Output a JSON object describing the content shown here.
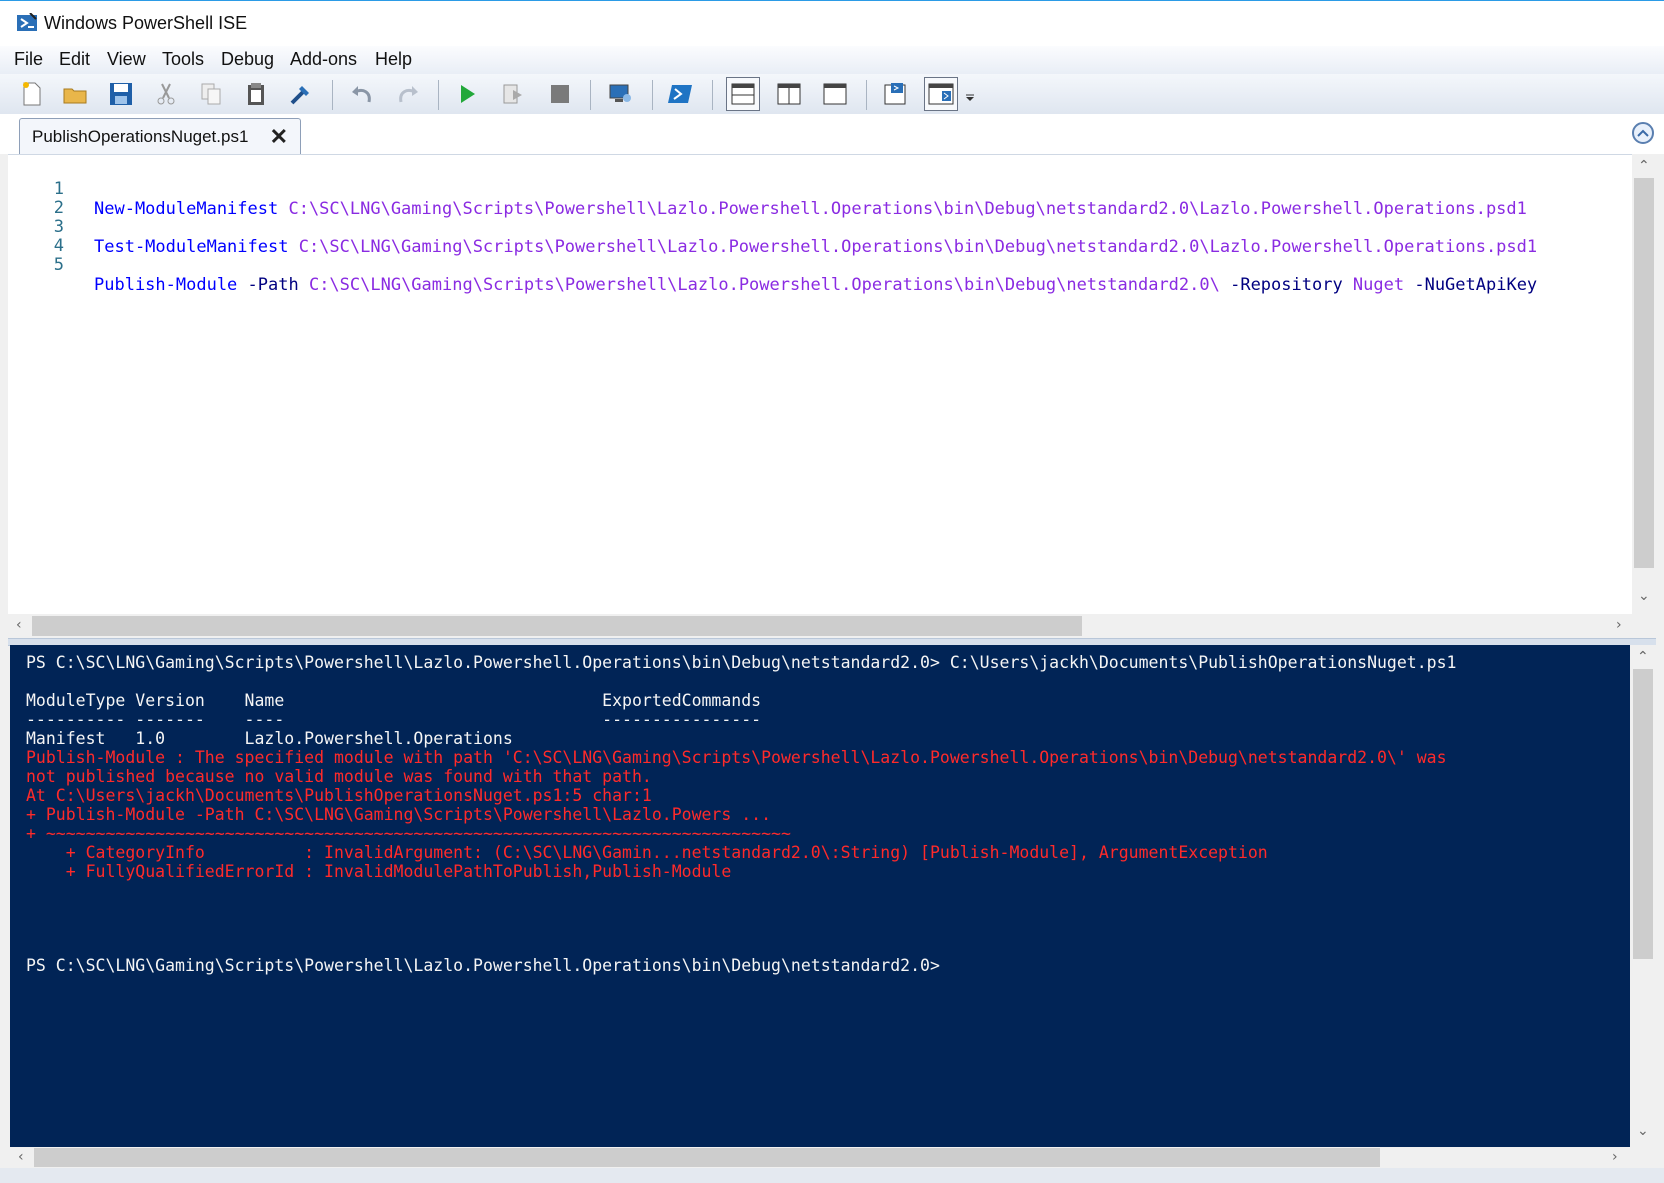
{
  "window": {
    "title": "Windows PowerShell ISE"
  },
  "menu": [
    "File",
    "Edit",
    "View",
    "Tools",
    "Debug",
    "Add-ons",
    "Help"
  ],
  "toolbar": {
    "buttons": [
      "new-file",
      "open",
      "save",
      "cut",
      "copy",
      "paste",
      "clear-console",
      "undo",
      "redo",
      "run-script",
      "run-selection",
      "stop",
      "new-remote-tab",
      "start-powershell",
      "show-script-pane-top",
      "show-script-pane-right",
      "show-script-pane-maximized",
      "show-script-pane",
      "show-commands",
      "toolbar-overflow"
    ]
  },
  "tabs": [
    {
      "label": "PublishOperationsNuget.ps1",
      "active": true
    }
  ],
  "editor": {
    "lines": [
      {
        "n": "1",
        "cmd": "New-ModuleManifest",
        "arg": " C:\\SC\\LNG\\Gaming\\Scripts\\Powershell\\Lazlo.Powershell.Operations\\bin\\Debug\\netstandard2.0\\Lazlo.Powershell.Operations.psd1"
      },
      {
        "n": "2"
      },
      {
        "n": "3",
        "cmd": "Test-ModuleManifest",
        "arg": " C:\\SC\\LNG\\Gaming\\Scripts\\Powershell\\Lazlo.Powershell.Operations\\bin\\Debug\\netstandard2.0\\Lazlo.Powershell.Operations.psd1"
      },
      {
        "n": "4"
      },
      {
        "n": "5",
        "cmd": "Publish-Module",
        "p1": " -Path",
        "arg": " C:\\SC\\LNG\\Gaming\\Scripts\\Powershell\\Lazlo.Powershell.Operations\\bin\\Debug\\netstandard2.0\\",
        "p2": " -Repository",
        "arg2": " Nuget",
        "p3": " -NuGetApiKey"
      }
    ]
  },
  "console": {
    "lines": [
      {
        "text": "PS C:\\SC\\LNG\\Gaming\\Scripts\\Powershell\\Lazlo.Powershell.Operations\\bin\\Debug\\netstandard2.0> C:\\Users\\jackh\\Documents\\PublishOperationsNuget.ps1",
        "type": "normal"
      },
      {
        "text": "",
        "type": "normal"
      },
      {
        "text": "ModuleType Version    Name                                ExportedCommands",
        "type": "normal"
      },
      {
        "text": "---------- -------    ----                                ----------------",
        "type": "normal"
      },
      {
        "text": "Manifest   1.0        Lazlo.Powershell.Operations",
        "type": "normal"
      },
      {
        "text": "Publish-Module : The specified module with path 'C:\\SC\\LNG\\Gaming\\Scripts\\Powershell\\Lazlo.Powershell.Operations\\bin\\Debug\\netstandard2.0\\' was",
        "type": "error"
      },
      {
        "text": "not published because no valid module was found with that path.",
        "type": "error"
      },
      {
        "text": "At C:\\Users\\jackh\\Documents\\PublishOperationsNuget.ps1:5 char:1",
        "type": "error"
      },
      {
        "text": "+ Publish-Module -Path C:\\SC\\LNG\\Gaming\\Scripts\\Powershell\\Lazlo.Powers ...",
        "type": "error"
      },
      {
        "text": "+ ~~~~~~~~~~~~~~~~~~~~~~~~~~~~~~~~~~~~~~~~~~~~~~~~~~~~~~~~~~~~~~~~~~~~~~~~~~~",
        "type": "error"
      },
      {
        "text": "    + CategoryInfo          : InvalidArgument: (C:\\SC\\LNG\\Gamin...netstandard2.0\\:String) [Publish-Module], ArgumentException",
        "type": "error"
      },
      {
        "text": "    + FullyQualifiedErrorId : InvalidModulePathToPublish,Publish-Module",
        "type": "error"
      }
    ],
    "prompt": "PS C:\\SC\\LNG\\Gaming\\Scripts\\Powershell\\Lazlo.Powershell.Operations\\bin\\Debug\\netstandard2.0>"
  },
  "colors": {
    "console_bg": "#012456",
    "error": "#ff2a2a",
    "cmdlet": "#0000ff",
    "argument": "#8a2be2"
  }
}
